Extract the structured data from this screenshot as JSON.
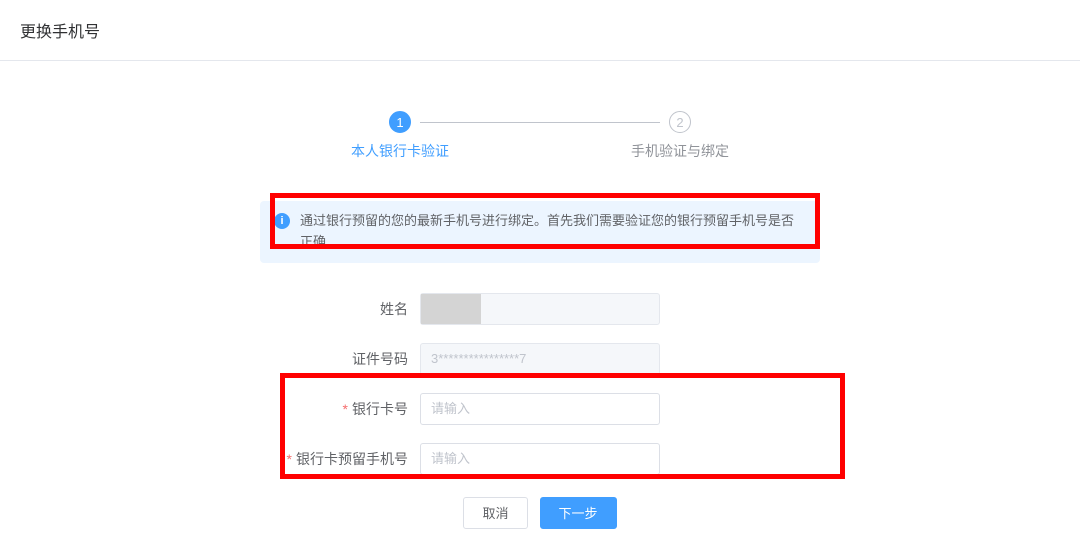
{
  "header": {
    "title": "更换手机号"
  },
  "steps": {
    "items": [
      {
        "num": "1",
        "label": "本人银行卡验证"
      },
      {
        "num": "2",
        "label": "手机验证与绑定"
      }
    ]
  },
  "alert": {
    "text": "通过银行预留的您的最新手机号进行绑定。首先我们需要验证您的银行预留手机号是否正确"
  },
  "form": {
    "name_label": "姓名",
    "id_label": "证件号码",
    "id_value": "3****************7",
    "card_label": "银行卡号",
    "card_placeholder": "请输入",
    "phone_label": "银行卡预留手机号",
    "phone_placeholder": "请输入"
  },
  "actions": {
    "cancel": "取消",
    "next": "下一步"
  }
}
